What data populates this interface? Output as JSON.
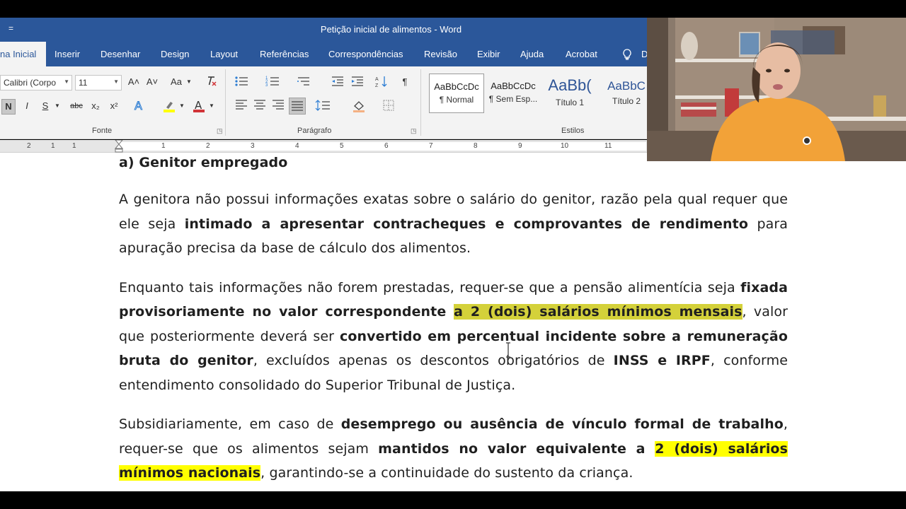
{
  "window": {
    "title": "Petição inicial de alimentos  -  Word",
    "quick_access": "="
  },
  "tabs": [
    "na Inicial",
    "Inserir",
    "Desenhar",
    "Design",
    "Layout",
    "Referências",
    "Correspondências",
    "Revisão",
    "Exibir",
    "Ajuda",
    "Acrobat",
    "D"
  ],
  "ribbon": {
    "font_name": "Calibri (Corpo",
    "font_size": "11",
    "grow_font": "A˄",
    "shrink_font": "A˅",
    "change_case": "Aa",
    "bold": "N",
    "italic": "I",
    "underline": "S",
    "strikethrough": "abc",
    "subscript": "x₂",
    "superscript": "x²",
    "pilcrow": "¶",
    "groups": {
      "font": "Fonte",
      "paragraph": "Parágrafo",
      "styles": "Estilos"
    },
    "styles": [
      {
        "sample": "AaBbCcDc",
        "name": "¶ Normal"
      },
      {
        "sample": "AaBbCcDc",
        "name": "¶ Sem Esp..."
      },
      {
        "sample": "AaBb(",
        "name": "Título 1"
      },
      {
        "sample": "AaBbC",
        "name": "Título 2"
      }
    ]
  },
  "ruler": {
    "numbers": [
      "2",
      "1",
      "1",
      "1",
      "2",
      "3",
      "4",
      "5",
      "6",
      "7",
      "8",
      "9",
      "10",
      "11"
    ]
  },
  "document": {
    "heading": "a) Genitor empregado",
    "paragraphs": {
      "p1": {
        "t1": "A genitora não possui informações exatas sobre o salário do genitor, razão pela qual requer que ele seja ",
        "b1": "intimado a apresentar contracheques e comprovantes de rendimento",
        "t2": " para apuração precisa da base de cálculo dos alimentos."
      },
      "p2": {
        "t1": "Enquanto tais informações não forem prestadas, requer-se que a pensão alimentícia seja ",
        "b1": "fixada provisoriamente no valor correspondente ",
        "h1": "a 2 (dois) salários mínimos mensais",
        "t2": ", valor que posteriormente deverá ser ",
        "b2": "convertido em percentual incidente sobre a remuneração bruta do genitor",
        "t3": ", excluídos apenas os descontos obrigatórios de ",
        "b3": "INSS e IRPF",
        "t4": ", conforme entendimento consolidado do Superior Tribunal de Justiça."
      },
      "p3": {
        "t1": "Subsidiariamente, em caso de ",
        "b1": "desemprego ou ausência de vínculo formal de trabalho",
        "t2": ", requer-se que os alimentos sejam ",
        "b2": "mantidos no valor equivalente a ",
        "h1": "2 (dois) salários mínimos nacionais",
        "t3": ", garantindo-se a continuidade do sustento da criança."
      }
    }
  },
  "colors": {
    "word_blue": "#2b579a",
    "highlight_olive": "#d4d13a",
    "highlight_yellow": "#ffff00"
  }
}
